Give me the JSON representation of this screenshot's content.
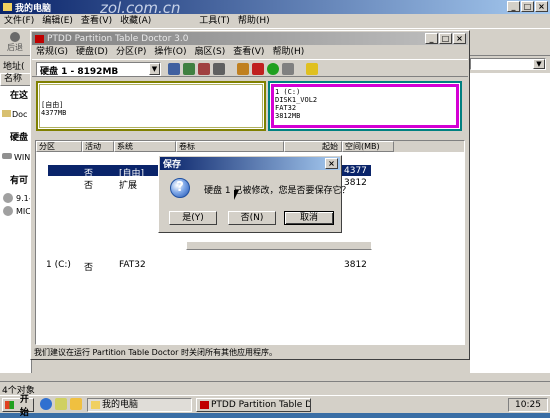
{
  "explorer": {
    "title": "我的电脑",
    "watermark": "zol.com.cn",
    "menu": [
      "文件(F)",
      "编辑(E)",
      "查看(V)",
      "收藏(A)",
      "工具(T)",
      "帮助(H)"
    ],
    "back_label": "后退",
    "address_label": "地址(",
    "left_header": "名称",
    "left_items": [
      "在这",
      "Doc",
      "硬盘",
      "WIN",
      "有可",
      "9.1-",
      "MIC"
    ],
    "status_count": "4个对象"
  },
  "ptdd": {
    "title": "PTDD Partition Table Doctor 3.0",
    "menu": [
      "常规(G)",
      "硬盘(D)",
      "分区(P)",
      "操作(O)",
      "扇区(S)",
      "查看(V)",
      "帮助(H)"
    ],
    "disk_select": "硬盘 1 - 8192MB",
    "map": {
      "free_label": "[自由]",
      "free_size": "4377MB",
      "part_lines": [
        "1 (C:)",
        "DISK1_VOL2",
        "FAT32",
        "3812MB"
      ]
    },
    "columns": [
      "分区",
      "活动",
      "系统",
      "卷标",
      "起始",
      "空间(MB)"
    ],
    "rows": [
      {
        "partition": "",
        "active": "否",
        "system": "[自由]",
        "label": "",
        "start": "",
        "size": "4377"
      },
      {
        "partition": "",
        "active": "否",
        "system": "扩展",
        "label": "",
        "start": "",
        "size": "3812"
      },
      {
        "partition": "1 (C:)",
        "active": "否",
        "system": "FAT32",
        "label": "",
        "start": "",
        "size": "3812"
      }
    ],
    "status": "我们建议在运行 Partition Table Doctor 时关闭所有其他应用程序。"
  },
  "dialog": {
    "title": "保存",
    "message": "硬盘 1 已被修改，您是否要保存它？",
    "yes": "是(Y)",
    "no": "否(N)",
    "cancel": "取消"
  },
  "taskbar": {
    "start": "开始",
    "tasks": [
      "我的电脑",
      "PTDD Partition Table Doc..."
    ],
    "clock": "10:25"
  },
  "colors": {
    "desktop": "#3a6ea5",
    "title_active": "#0a246a",
    "free_space": "#808000",
    "partition_border": "#d400d4",
    "partition_inner": "#00a0a0",
    "selection": "#0a246a"
  }
}
